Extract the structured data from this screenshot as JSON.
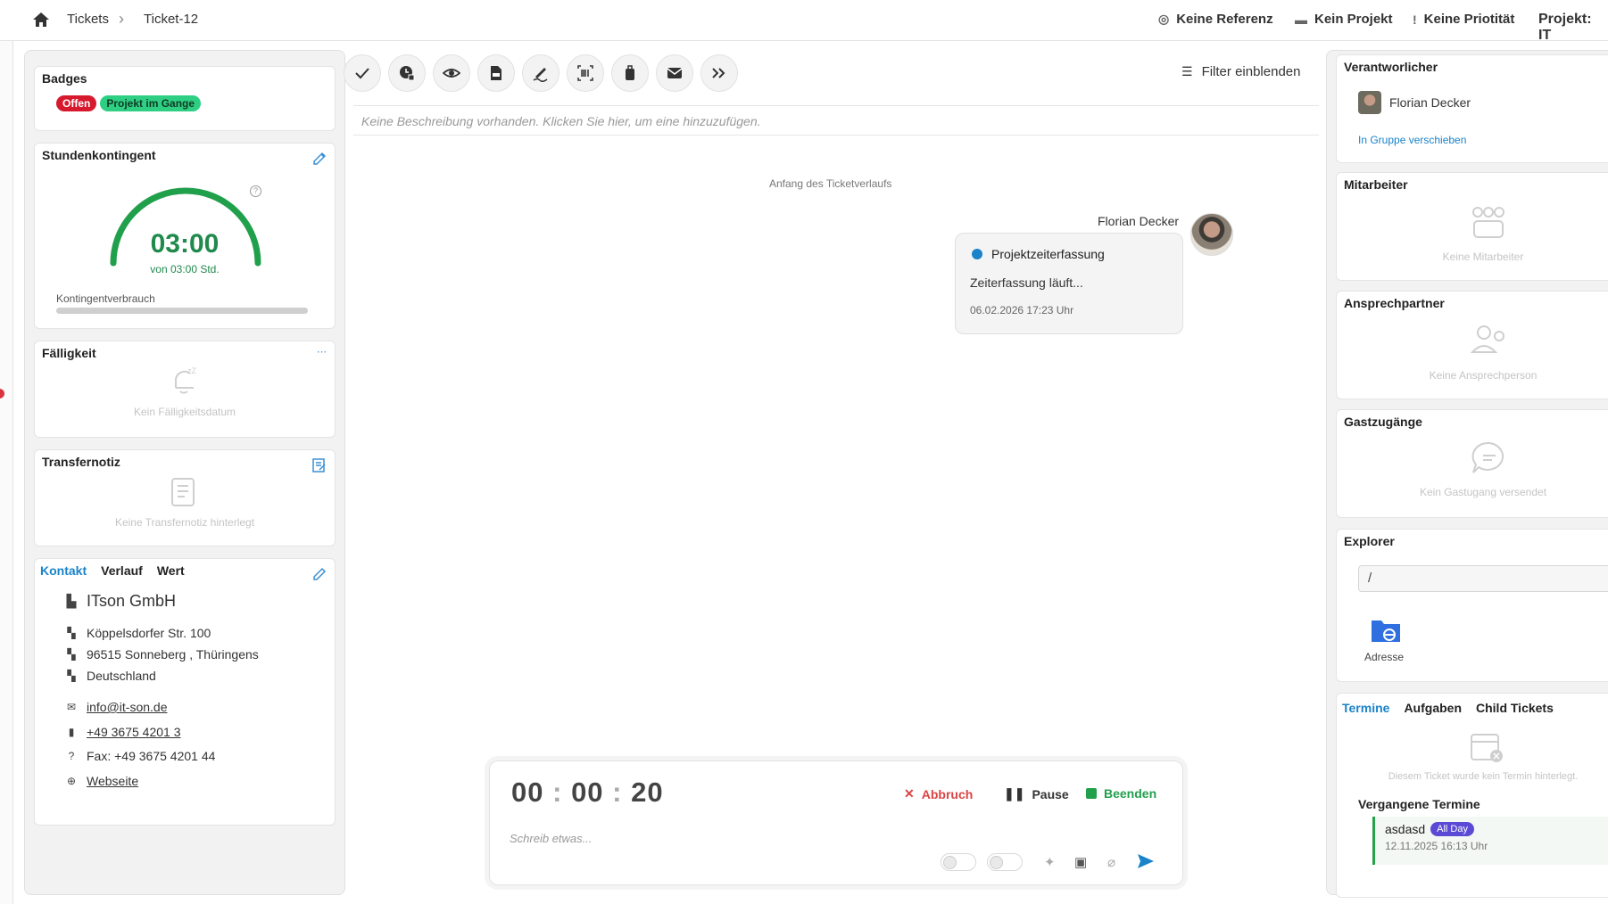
{
  "header": {
    "breadcrumb": [
      "Tickets",
      "Ticket-12"
    ],
    "ref": "Keine Referenz",
    "project": "Kein Projekt",
    "priority": "Keine Priotität",
    "project_label": "Projekt: IT"
  },
  "left": {
    "badges": {
      "title": "Badges",
      "items": [
        "Offen",
        "Projekt im Gange"
      ],
      "colors": [
        "#d7192e",
        "#2fcf83"
      ]
    },
    "quota": {
      "title": "Stundenkontingent",
      "time": "03:00",
      "of": "von 03:00 Std.",
      "usage_label": "Kontingentverbrauch",
      "usage_pct": 0,
      "gauge_pct": 100
    },
    "due": {
      "title": "Fälligkeit",
      "empty": "Kein Fälligkeitsdatum"
    },
    "transfer": {
      "title": "Transfernotiz",
      "empty": "Keine Transfernotiz hinterlegt"
    },
    "contact": {
      "tabs": [
        "Kontakt",
        "Verlauf",
        "Wert"
      ],
      "company": "ITson GmbH",
      "street": "Köppelsdorfer Str. 100",
      "city": "96515 Sonneberg , Thüringens",
      "country": "Deutschland",
      "email": "info@it-son.de",
      "phone": "+49 3675 4201 3",
      "fax": "Fax: +49 3675 4201 44",
      "web": "Webseite"
    }
  },
  "main": {
    "filter": "Filter einblenden",
    "description_placeholder": "Keine Beschreibung vorhanden. Klicken Sie hier, um eine hinzuzufügen.",
    "timeline_start": "Anfang des Ticketverlaufs",
    "message": {
      "author": "Florian Decker",
      "title": "Projektzeiterfassung",
      "body": "Zeiterfassung läuft...",
      "date": "06.02.2026 17:23 Uhr"
    },
    "timer": {
      "h": "00",
      "m": "00",
      "s": "20",
      "abort": "Abbruch",
      "pause": "Pause",
      "finish": "Beenden",
      "placeholder": "Schreib etwas..."
    }
  },
  "right": {
    "owner": {
      "title": "Verantworlicher",
      "name": "Florian Decker",
      "link": "In Gruppe verschieben"
    },
    "staff": {
      "title": "Mitarbeiter",
      "empty": "Keine Mitarbeiter"
    },
    "contact": {
      "title": "Ansprechpartner",
      "empty": "Keine Ansprechperson"
    },
    "guest": {
      "title": "Gastzugänge",
      "empty": "Kein Gastugang versendet"
    },
    "explorer": {
      "title": "Explorer",
      "path": "/",
      "folder": "Adresse"
    },
    "events": {
      "tabs": [
        "Termine",
        "Aufgaben",
        "Child Tickets"
      ],
      "empty": "Diesem Ticket wurde kein Termin hinterlegt.",
      "past_title": "Vergangene Termine",
      "item_name": "asdasd",
      "item_badge": "All Day",
      "item_date": "12.11.2025 16:13 Uhr"
    }
  }
}
